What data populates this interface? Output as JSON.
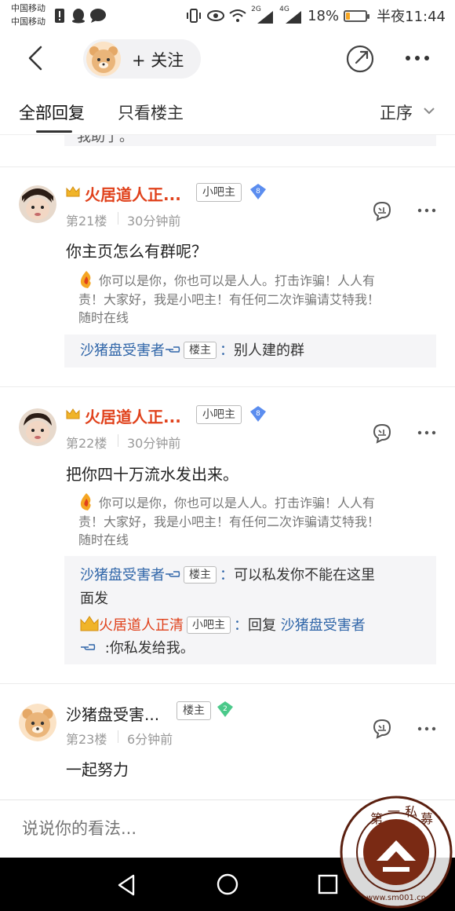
{
  "status_bar": {
    "carrier_1": "中国移动",
    "carrier_2": "中国移动",
    "battery_text": "18%",
    "battery_level": 0.18,
    "time": "半夜11:44",
    "net_1": "2G",
    "net_2": "4G"
  },
  "nav": {
    "follow_label": "+ 关注",
    "back_icon": "chevron-left-icon",
    "share_icon": "share-icon",
    "more_icon": "more-dots-icon"
  },
  "tabs": {
    "all_replies": "全部回复",
    "only_op": "只看楼主",
    "sort_label": "正序"
  },
  "prev_remnant": "我助了。",
  "posts": [
    {
      "username": "火居道人正...",
      "role_badge": "小吧主",
      "level": "8",
      "floor": "第21楼",
      "time": "30分钟前",
      "content": "你主页怎么有群呢？",
      "signature_line1": "你可以是你，你也可以是人人。打击诈骗！人人有",
      "signature_line2": "责！大家好，我是小吧主！有任何二次诈骗请艾特我！",
      "signature_line3": "随时在线",
      "sub_replies": [
        {
          "name": "沙猪盘受害者",
          "badge": "楼主",
          "colon": "：",
          "text": "别人建的群"
        }
      ]
    },
    {
      "username": "火居道人正...",
      "role_badge": "小吧主",
      "level": "8",
      "floor": "第22楼",
      "time": "30分钟前",
      "content": "把你四十万流水发出来。",
      "signature_line1": "你可以是你，你也可以是人人。打击诈骗！人人有",
      "signature_line2": "责！大家好，我是小吧主！有任何二次诈骗请艾特我！",
      "signature_line3": "随时在线",
      "sub_replies": [
        {
          "name": "沙猪盘受害者",
          "badge": "楼主",
          "colon": "：",
          "text": "可以私发你不能在这里",
          "text_cont": "面发"
        },
        {
          "name": "火居道人正清",
          "badge": "小吧主",
          "colon": "：",
          "text": "回复",
          "reply_to": "沙猪盘受害者",
          "text_cont": ":你私发给我。"
        }
      ]
    },
    {
      "username": "沙猪盘受害...",
      "role_badge": "楼主",
      "level": "2",
      "floor": "第23楼",
      "time": "6分钟前",
      "content": "一起努力"
    }
  ],
  "reply_bar": {
    "placeholder": "说说你的看法..."
  },
  "watermark": {
    "chars": [
      "第",
      "一",
      "私",
      "募"
    ],
    "url": "www.sm001.cn"
  },
  "colors": {
    "username_red": "#e0411b",
    "link_blue": "#2f65a8",
    "subbox_bg": "#f5f5f7",
    "level_blue": "#5b8def",
    "level_green": "#4bc98a"
  }
}
